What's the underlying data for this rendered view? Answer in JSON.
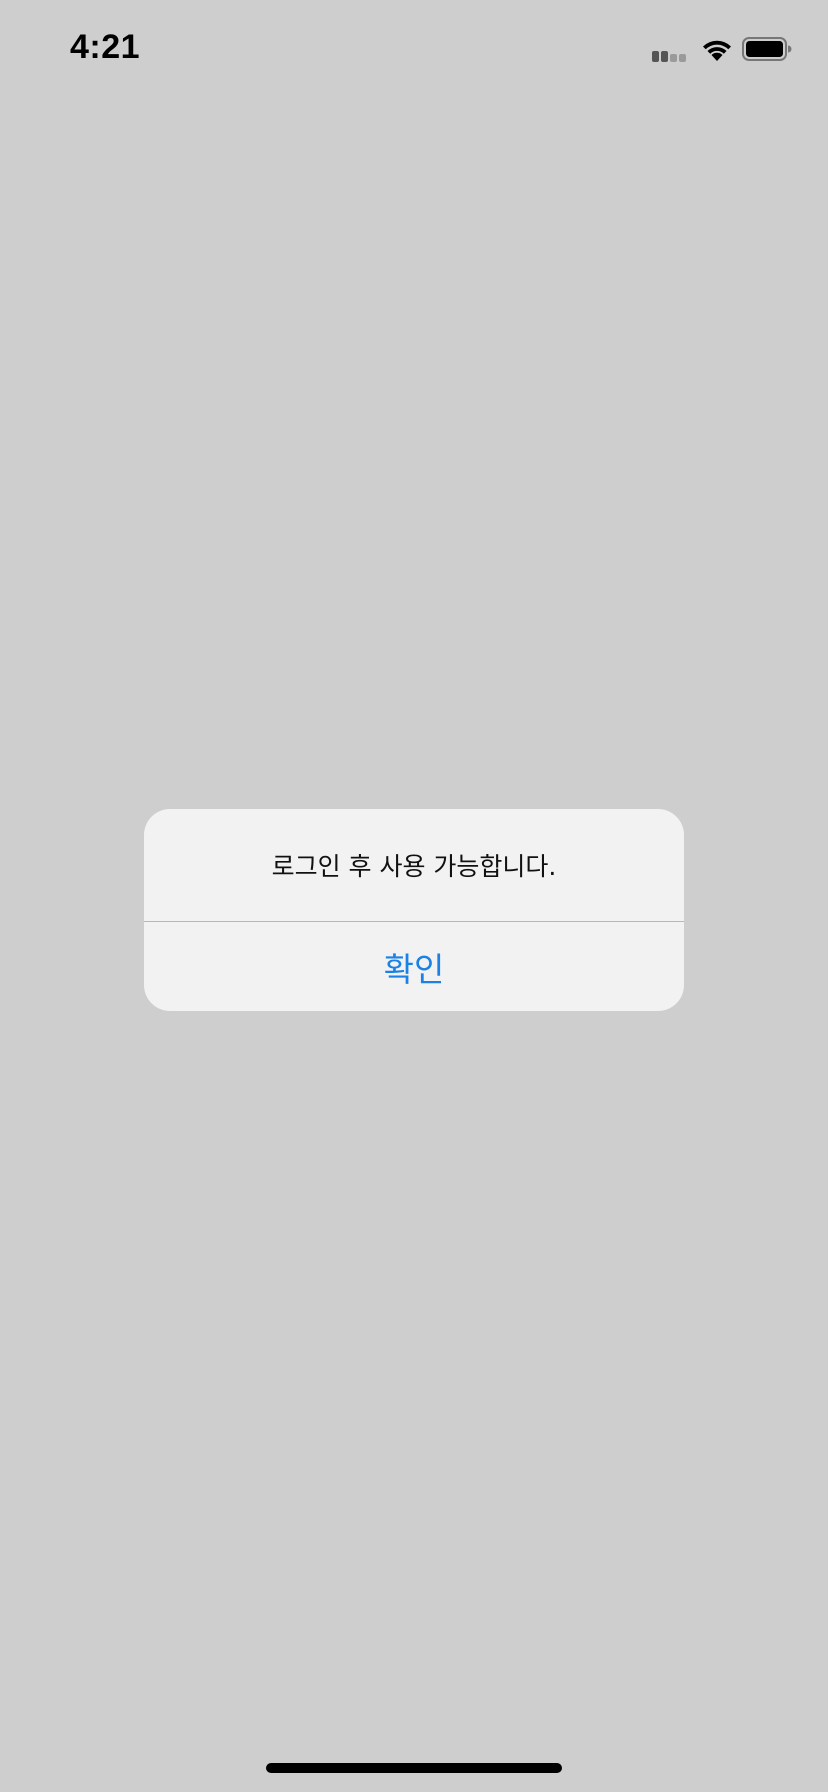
{
  "status_bar": {
    "time": "4:21",
    "signal_icon": "cellular-signal-icon",
    "wifi_icon": "wifi-icon",
    "battery_icon": "battery-icon"
  },
  "alert": {
    "message": "로그인 후 사용 가능합니다.",
    "confirm_label": "확인"
  },
  "colors": {
    "background": "#cecece",
    "alert_background": "#f2f2f2",
    "accent": "#1a82e6"
  }
}
